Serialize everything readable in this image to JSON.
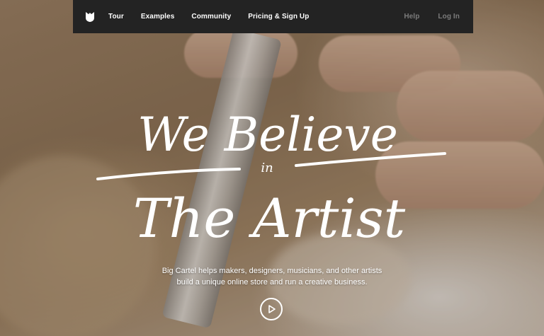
{
  "nav": {
    "logo_icon": "big-cartel-logo-icon",
    "links": [
      "Tour",
      "Examples",
      "Community",
      "Pricing & Sign Up"
    ],
    "right_links": [
      "Help",
      "Log In"
    ]
  },
  "hero": {
    "headline_line1": "We Believe",
    "headline_connector": "in",
    "headline_line2": "The Artist",
    "tagline_line1": "Big Cartel helps makers, designers, musicians, and other artists",
    "tagline_line2": "build a unique online store and run a creative business.",
    "play_icon": "play-icon"
  },
  "colors": {
    "navbar": "#232323",
    "nav_link": "#ffffff",
    "nav_link_muted": "#7b7b7b",
    "text": "#ffffff"
  }
}
